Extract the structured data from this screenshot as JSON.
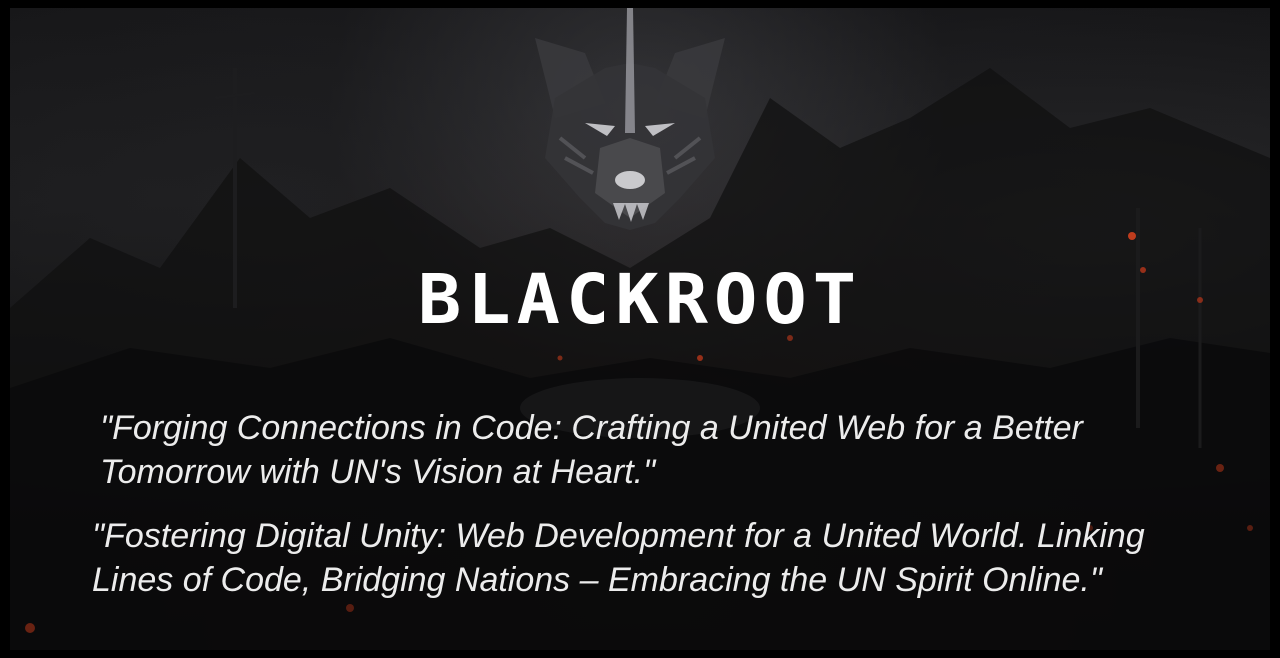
{
  "hero": {
    "logo_icon": "wolf-head-icon",
    "brand_title": "BLACKROOT",
    "quotes": [
      "\"Forging Connections in Code: Crafting a United Web for a Better Tomorrow with UN's Vision at Heart.\"",
      "\"Fostering Digital Unity: Web Development for a United World. Linking Lines of Code, Bridging Nations – Embracing the UN Spirit Online.\""
    ]
  },
  "colors": {
    "background": "#141416",
    "text": "#ffffff",
    "ember_accent": "#d2401e"
  }
}
